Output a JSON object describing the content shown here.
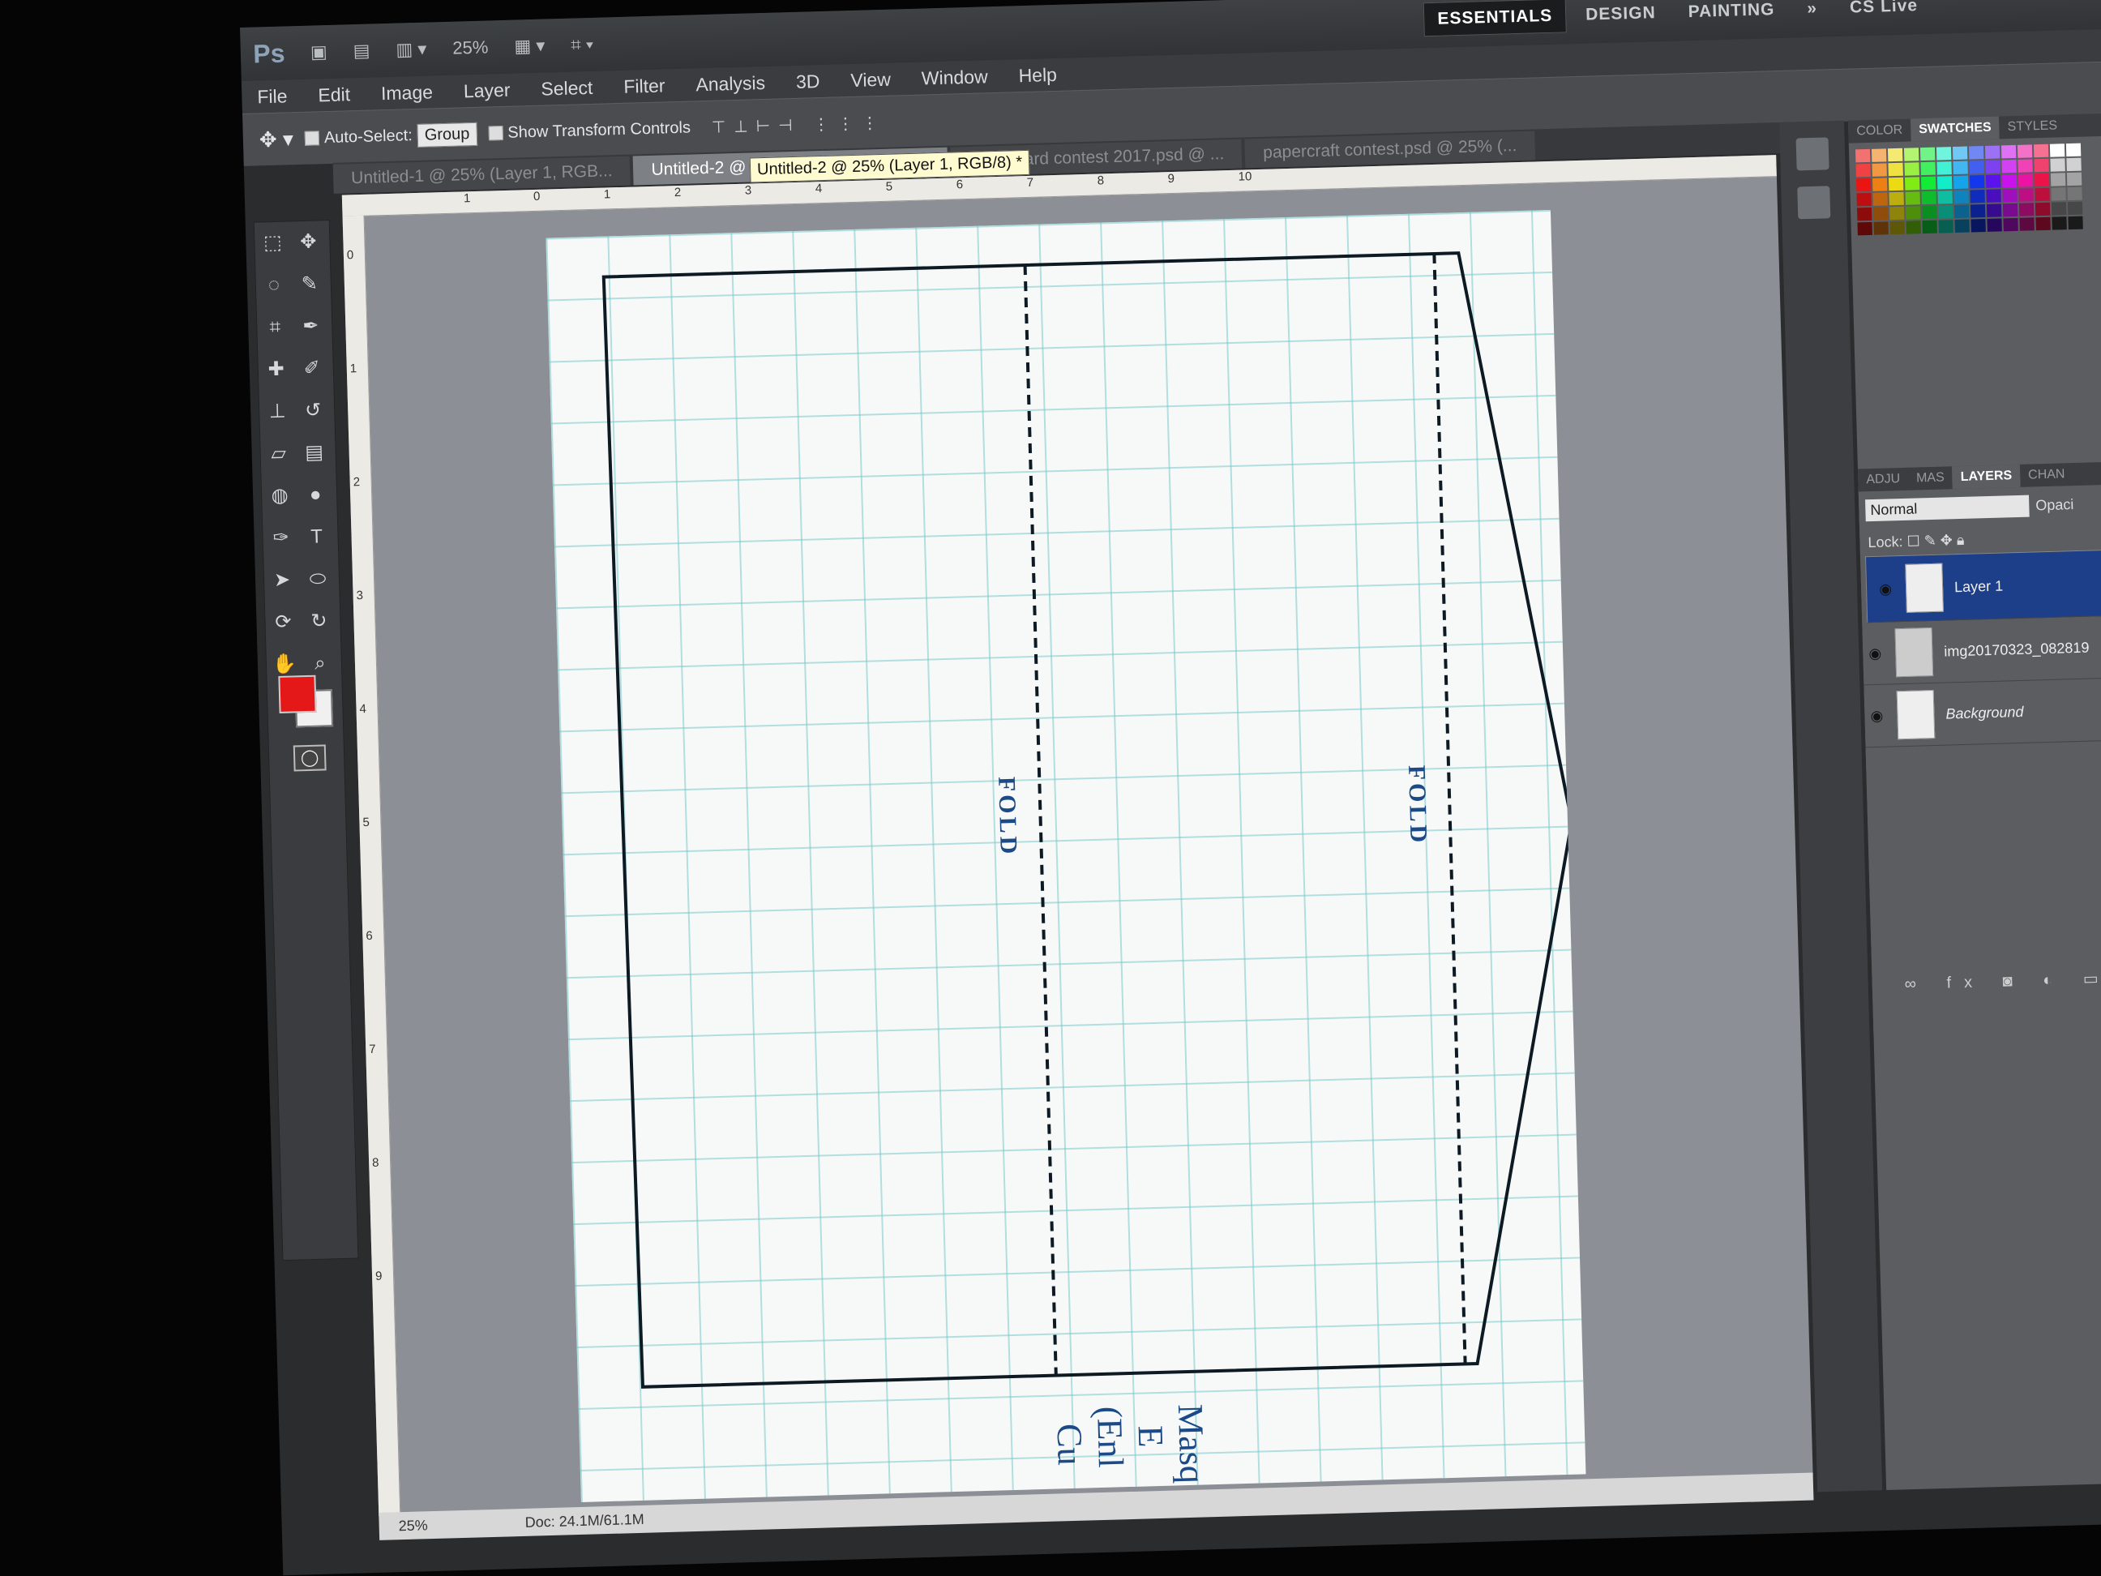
{
  "app": {
    "logo": "Ps",
    "zoom_level": "25%",
    "workspaces": [
      "ESSENTIALS",
      "DESIGN",
      "PAINTING",
      "»"
    ],
    "cs_live": "CS Live"
  },
  "menu": [
    "File",
    "Edit",
    "Image",
    "Layer",
    "Select",
    "Filter",
    "Analysis",
    "3D",
    "View",
    "Window",
    "Help"
  ],
  "options": {
    "auto_select_label": "Auto-Select:",
    "auto_select_value": "Group",
    "show_transform_label": "Show Transform Controls"
  },
  "tooltip": "Untitled-2 @ 25% (Layer 1, RGB/8) *",
  "tabs": [
    {
      "label": "Untitled-1 @ 25% (Layer 1, RGB..."
    },
    {
      "label": "Untitled-2 @ 25% (Layer 1, RGB/8) *"
    },
    {
      "label": "Cardboard contest 2017.psd @ ..."
    },
    {
      "label": "papercraft contest.psd @ 25% (..."
    }
  ],
  "ruler": {
    "top": [
      "1",
      "0",
      "1",
      "2",
      "3",
      "4",
      "5",
      "6",
      "7",
      "8",
      "9",
      "10"
    ],
    "left": [
      "0",
      "1",
      "2",
      "3",
      "4",
      "5",
      "6",
      "7",
      "8",
      "9"
    ]
  },
  "canvas": {
    "fold_left": "FOLD",
    "fold_right": "FOLD",
    "bottom_text": [
      "Masq",
      "E",
      "(Enl",
      "Cu"
    ]
  },
  "status": {
    "zoom": "25%",
    "doc": "Doc: 24.1M/61.1M"
  },
  "panels": {
    "top_tabs": [
      "COLOR",
      "SWATCHES",
      "STYLES"
    ],
    "layer_tabs": [
      "ADJU",
      "MAS",
      "LAYERS",
      "CHAN"
    ],
    "blend_mode": "Normal",
    "opacity_label": "Opaci",
    "lock_label": "Lock:",
    "layers": [
      {
        "name": "Layer 1",
        "selected": true
      },
      {
        "name": "img20170323_082819",
        "selected": false
      },
      {
        "name": "Background",
        "selected": false
      }
    ]
  },
  "colors": {
    "foreground": "#e41818",
    "background": "#f0f0f0",
    "selected_layer": "#1d3f8a"
  }
}
